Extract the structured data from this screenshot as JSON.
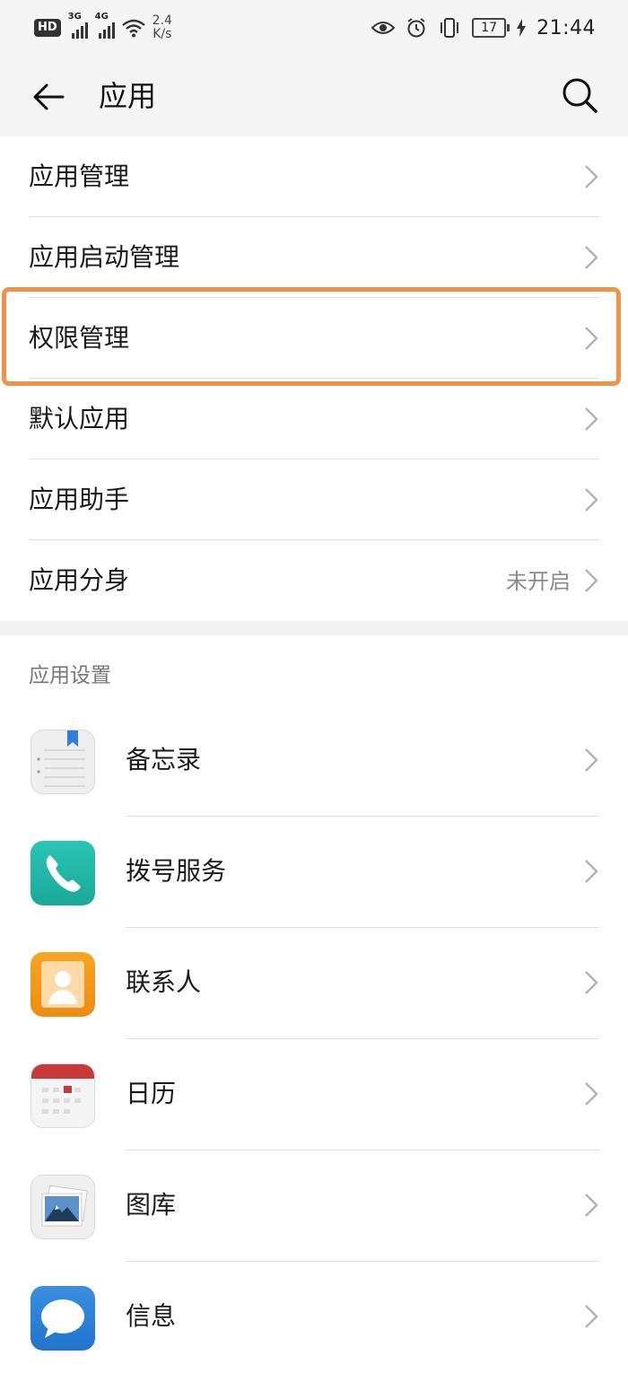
{
  "status_bar": {
    "hd_label": "HD",
    "sim1_network": "3G",
    "sim2_network": "4G",
    "net_speed_value": "2.4",
    "net_speed_unit": "K/s",
    "battery_level": "17",
    "time": "21:44"
  },
  "app_bar": {
    "title": "应用",
    "back_icon": "arrow-left-icon",
    "search_icon": "search-icon"
  },
  "menu": {
    "items": [
      {
        "label": "应用管理",
        "value": ""
      },
      {
        "label": "应用启动管理",
        "value": ""
      },
      {
        "label": "权限管理",
        "value": ""
      },
      {
        "label": "默认应用",
        "value": ""
      },
      {
        "label": "应用助手",
        "value": ""
      },
      {
        "label": "应用分身",
        "value": "未开启"
      }
    ]
  },
  "app_settings": {
    "header": "应用设置",
    "apps": [
      {
        "label": "备忘录",
        "icon": "notepad-icon"
      },
      {
        "label": "拨号服务",
        "icon": "phone-icon"
      },
      {
        "label": "联系人",
        "icon": "contact-icon"
      },
      {
        "label": "日历",
        "icon": "calendar-icon"
      },
      {
        "label": "图库",
        "icon": "gallery-icon"
      },
      {
        "label": "信息",
        "icon": "message-icon"
      }
    ]
  },
  "colors": {
    "highlight": "#f0924a",
    "background": "#f5f5f5"
  }
}
